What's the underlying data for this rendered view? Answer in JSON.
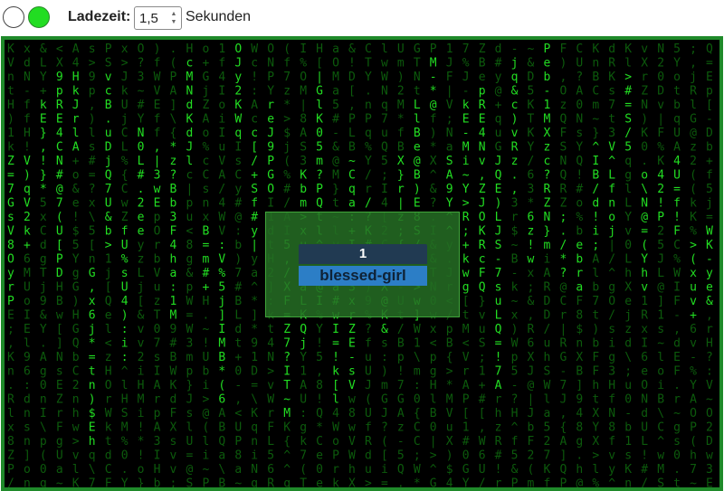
{
  "toolbar": {
    "load_time_label": "Ladezeit:",
    "load_time_value": "1,5",
    "unit_label": "Sekunden",
    "indicator_on_color": "#22dd22"
  },
  "card": {
    "number": "1",
    "name": "blessed-girl"
  },
  "rain": {
    "glyph_color": "#22dd22",
    "dim_color": "#0c5a0c",
    "background": "#000000",
    "columns": [
      "%M",
      ":zz>L",
      "I@~wkE",
      "6Z9pRE4",
      "u",
      "3jq&c)vRz.",
      "6",
      "Pe",
      "fAf94HN",
      "[",
      "k",
      "*c",
      "j:",
      "k[",
      "OJ",
      "v",
      "$%L@",
      "~",
      "B",
      "uv|",
      "0",
      "ZsPe{",
      "Y",
      "~",
      "W@7PeA",
      ".PfLLl"
    ]
  }
}
